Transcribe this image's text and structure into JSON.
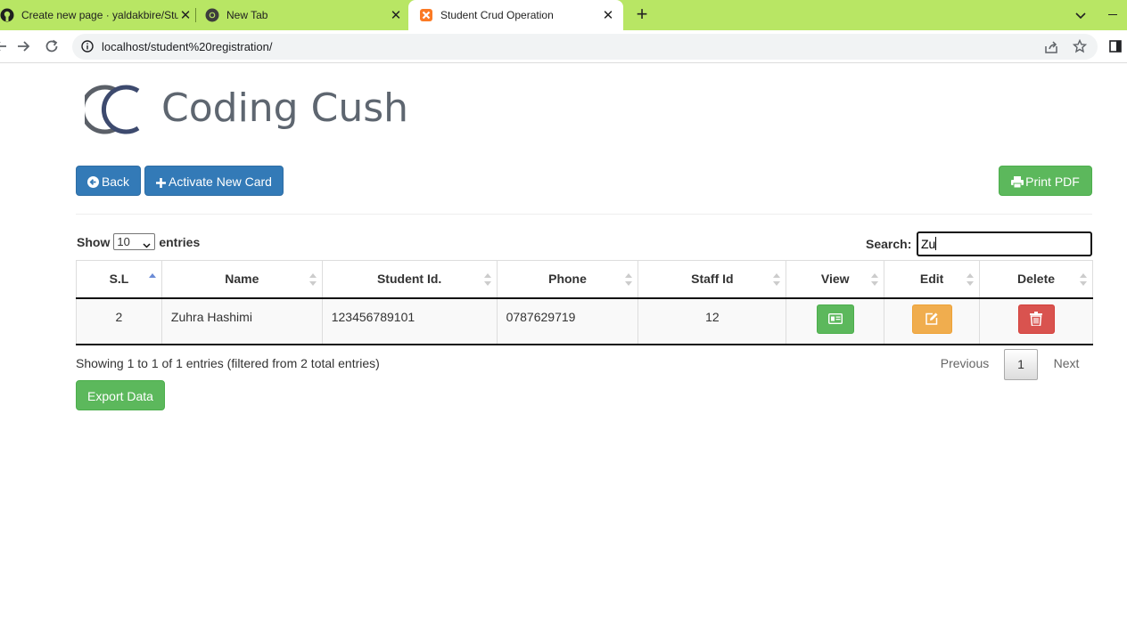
{
  "browser": {
    "tabs": [
      {
        "title": "Create new page · yaldakbire/Stu",
        "icon": "github-icon"
      },
      {
        "title": "New Tab",
        "icon": "chrome-icon"
      },
      {
        "title": "Student Crud Operation",
        "icon": "xampp-icon"
      }
    ],
    "url": "localhost/student%20registration/",
    "accent_color": "#b8e664"
  },
  "header": {
    "logo_text": "Coding Cush"
  },
  "actions": {
    "back_label": "Back",
    "activate_label": "Activate New Card",
    "print_label": "Print PDF",
    "export_label": "Export Data"
  },
  "table_controls": {
    "show_label": "Show",
    "page_length": "10",
    "entries_label": "entries",
    "search_label": "Search:",
    "search_value": "Zu"
  },
  "table": {
    "columns": [
      "S.L",
      "Name",
      "Student Id.",
      "Phone",
      "Staff Id",
      "View",
      "Edit",
      "Delete"
    ],
    "rows": [
      {
        "sl": "2",
        "name": "Zuhra Hashimi",
        "student_id": "123456789101",
        "phone": "0787629719",
        "staff_id": "12"
      }
    ]
  },
  "footer": {
    "info": "Showing 1 to 1 of 1 entries (filtered from 2 total entries)",
    "previous": "Previous",
    "page": "1",
    "next": "Next"
  }
}
